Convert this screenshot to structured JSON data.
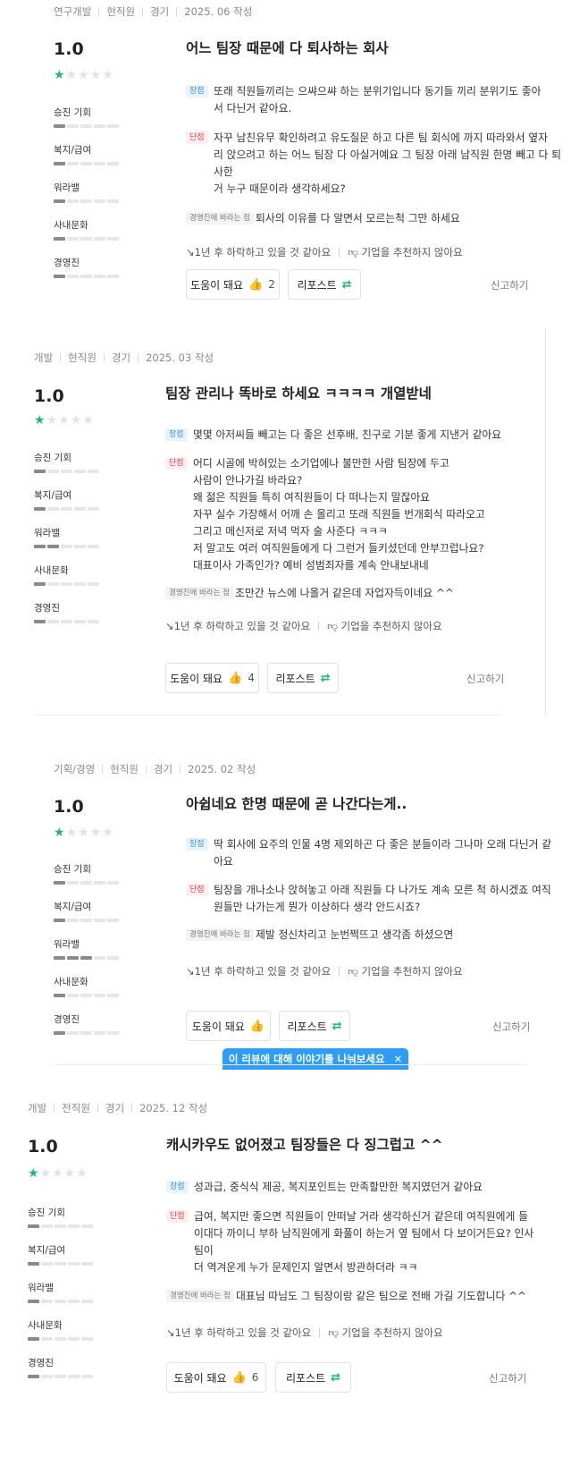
{
  "reviews": [
    {
      "meta": [
        "연구개발",
        "현직원",
        "경기",
        "2025. 06 작성"
      ],
      "score": "1.0",
      "stars_filled": 1,
      "ratings": [
        {
          "label": "승진 기회",
          "filled": 1
        },
        {
          "label": "복지/급여",
          "filled": 1
        },
        {
          "label": "워라밸",
          "filled": 1
        },
        {
          "label": "사내문화",
          "filled": 1
        },
        {
          "label": "경영진",
          "filled": 1
        }
      ],
      "title": "어느 팀장 때문에 다 퇴사하는 회사",
      "pros_tag": "장점",
      "pros": [
        "또래 직원들끼리는 으쌰으쌰 하는 분위기입니다 동기들 끼리 분위기도 좋아",
        "서 다닌거 같아요."
      ],
      "cons_tag": "단점",
      "cons": [
        "자꾸 남친유무 확인하려고 유도질문 하고 다른 팀 회식에 까지 따라와서 옆자",
        "리 앉으려고 하는 어느 팀장 다 아실거예요 그 팀장 아래 남직원 한명 빼고 다 퇴사한",
        "거 누구 때문이라 생각하세요?"
      ],
      "wish_tag": "경영진에 바라는 점",
      "wish": "퇴사의 이유를 다 알면서 모르는척 그만 하세요",
      "outlook": "1년 후 하락하고 있을 것 같아요",
      "recommend": "기업을 추천하지 않아요",
      "helpful_label": "도움이 돼요",
      "helpful_count": "2",
      "share_label": "리포스트",
      "report_label": "신고하기"
    },
    {
      "meta": [
        "개발",
        "현직원",
        "경기",
        "2025. 03 작성"
      ],
      "score": "1.0",
      "stars_filled": 1,
      "ratings": [
        {
          "label": "승진 기회",
          "filled": 1
        },
        {
          "label": "복지/급여",
          "filled": 1
        },
        {
          "label": "워라밸",
          "filled": 2
        },
        {
          "label": "사내문화",
          "filled": 1
        },
        {
          "label": "경영진",
          "filled": 1
        }
      ],
      "title": "팀장 관리나 똑바로 하세요 ㅋㅋㅋㅋ 개열받네",
      "pros_tag": "장점",
      "pros": [
        "몇몇 아저씨들 빼고는 다 좋은 선후배, 친구로 기분 좋게 지낸거 같아요"
      ],
      "cons_tag": "단점",
      "cons": [
        "어디 시골에 박혀있는 소기업에나 불만한 사람 팀장에 두고",
        "사람이 안나가길 바라요?",
        "왜 젊은 직원들 특히 여직원들이 다 떠나는지 말잖아요",
        "자꾸 실수 가장해서 어깨 손 올리고 또래 직원들 번개회식 따라오고",
        "그리고 메신저로 저녁 먹자 술 사준다 ㅋㅋㅋ",
        "저 말고도 여러 여직원들에게 다 그런거 들키셨던데 안부끄럽나요?",
        "대표이사 가족인가? 예비 성범죄자를 계속 안내보내네"
      ],
      "wish_tag": "경영진에 바라는 점",
      "wish": "조만간 뉴스에 나올거 같은데 자업자득이네요 ^^",
      "outlook": "1년 후 하락하고 있을 것 같아요",
      "recommend": "기업을 추천하지 않아요",
      "helpful_label": "도움이 돼요",
      "helpful_count": "4",
      "share_label": "리포스트",
      "report_label": "신고하기"
    },
    {
      "meta": [
        "기획/경영",
        "현직원",
        "경기",
        "2025. 02 작성"
      ],
      "score": "1.0",
      "stars_filled": 1,
      "ratings": [
        {
          "label": "승진 기회",
          "filled": 1
        },
        {
          "label": "복지/급여",
          "filled": 1
        },
        {
          "label": "워라밸",
          "filled": 3
        },
        {
          "label": "사내문화",
          "filled": 1
        },
        {
          "label": "경영진",
          "filled": 1
        }
      ],
      "title": "아쉽네요 한명 때문에 곧 나간다는게..",
      "pros_tag": "장점",
      "pros": [
        "딱 회사에 요주의 인물 4명 제외하곤 다 좋은 분들이라 그나마 오래 다닌거 같",
        "아요"
      ],
      "cons_tag": "단점",
      "cons": [
        "팀장을 개나소나 앉혀놓고 아래 직원들 다 나가도 계속 모른 척 하시겠죠 여직",
        "원들만 나가는게 뭔가 이상하다 생각 안드시죠?"
      ],
      "wish_tag": "경영진에 바라는 점",
      "wish": "제발 정신차리고 눈번쩍뜨고 생각좀 하셨으면",
      "outlook": "1년 후 하락하고 있을 것 같아요",
      "recommend": "기업을 추천하지 않아요",
      "helpful_label": "도움이 돼요",
      "helpful_count": "",
      "share_label": "리포스트",
      "report_label": "신고하기"
    },
    {
      "meta": [
        "개발",
        "전직원",
        "경기",
        "2025. 12 작성"
      ],
      "score": "1.0",
      "stars_filled": 1,
      "ratings": [
        {
          "label": "승진 기회",
          "filled": 1
        },
        {
          "label": "복지/급여",
          "filled": 1
        },
        {
          "label": "워라밸",
          "filled": 1
        },
        {
          "label": "사내문화",
          "filled": 1
        },
        {
          "label": "경영진",
          "filled": 1
        }
      ],
      "title": "캐시카우도 없어졌고 팀장들은 다 징그럽고 ^^",
      "pros_tag": "장점",
      "pros": [
        "성과급, 중식식 제공, 복지포인트는 만족할만한 복지였던거 같아요"
      ],
      "cons_tag": "단점",
      "cons": [
        "급여, 복지만 좋으면 직원들이 안떠날 거라 생각하신거 같은데 여직원에게 들",
        "이대다 까이니 부하 남직원에게 화풀이 하는거 옆 팀에서 다 보이거든요? 인사팀이",
        "더 역겨운게 누가 문제인지 알면서 방관하더라 ㅋㅋ"
      ],
      "wish_tag": "경영진에 바라는 점",
      "wish": "대표님 따님도 그 팀장이랑 같은 팀으로 전배 가길 기도합니다 ^^",
      "outlook": "1년 후 하락하고 있을 것 같아요",
      "recommend": "기업을 추천하지 않아요",
      "helpful_label": "도움이 돼요",
      "helpful_count": "6",
      "share_label": "리포스트",
      "report_label": "신고하기"
    }
  ],
  "popup": {
    "text": "이 리뷰에 대해 이야기를 나눠보세요",
    "close": "✕"
  },
  "icons": {
    "trend": "trend-down-icon",
    "thumb_down": "thumb-down-icon",
    "thumb_up": "thumb-up-icon",
    "repost": "repost-icon"
  },
  "colors": {
    "star": "#22b573",
    "pros": "#3a8ee6",
    "cons": "#e5484d",
    "popup": "#2f9cf5"
  }
}
